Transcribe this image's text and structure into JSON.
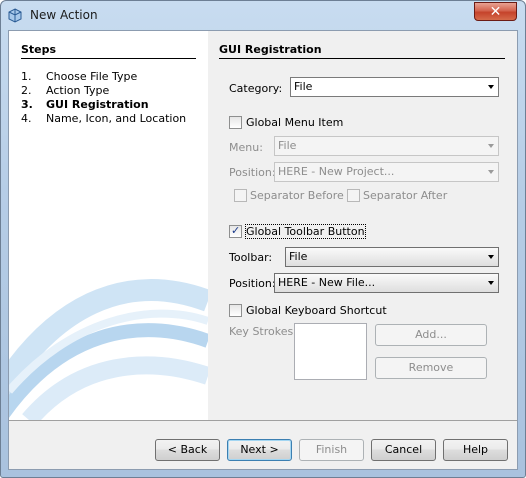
{
  "window": {
    "title": "New Action",
    "close_label": "✕"
  },
  "steps": {
    "title": "Steps",
    "items": [
      {
        "num": "1.",
        "label": "Choose File Type",
        "current": false
      },
      {
        "num": "2.",
        "label": "Action Type",
        "current": false
      },
      {
        "num": "3.",
        "label": "GUI Registration",
        "current": true
      },
      {
        "num": "4.",
        "label": "Name, Icon, and Location",
        "current": false
      }
    ]
  },
  "panel": {
    "title": "GUI Registration",
    "category": {
      "label": "Category:",
      "value": "File"
    },
    "global_menu_item": {
      "label": "Global Menu Item",
      "checked": false
    },
    "menu": {
      "label": "Menu:",
      "value": "File"
    },
    "menu_position": {
      "label": "Position:",
      "value": "HERE - New Project..."
    },
    "separator_before": {
      "label": "Separator Before",
      "checked": false
    },
    "separator_after": {
      "label": "Separator After",
      "checked": false
    },
    "global_toolbar_button": {
      "label": "Global Toolbar Button",
      "checked": true
    },
    "toolbar": {
      "label": "Toolbar:",
      "value": "File"
    },
    "toolbar_position": {
      "label": "Position:",
      "value": "HERE - New File..."
    },
    "global_keyboard_shortcut": {
      "label": "Global Keyboard Shortcut",
      "checked": false
    },
    "key_strokes": {
      "label": "Key Strokes:"
    },
    "add_label": "Add...",
    "remove_label": "Remove"
  },
  "buttons": {
    "back": "< Back",
    "next": "Next >",
    "finish": "Finish",
    "cancel": "Cancel",
    "help": "Help"
  },
  "colors": {
    "title_bar": "#b6cde6",
    "close_button": "#c5432b",
    "panel_bg": "#f0f0f0",
    "default_button_border": "#3c7fb1"
  }
}
